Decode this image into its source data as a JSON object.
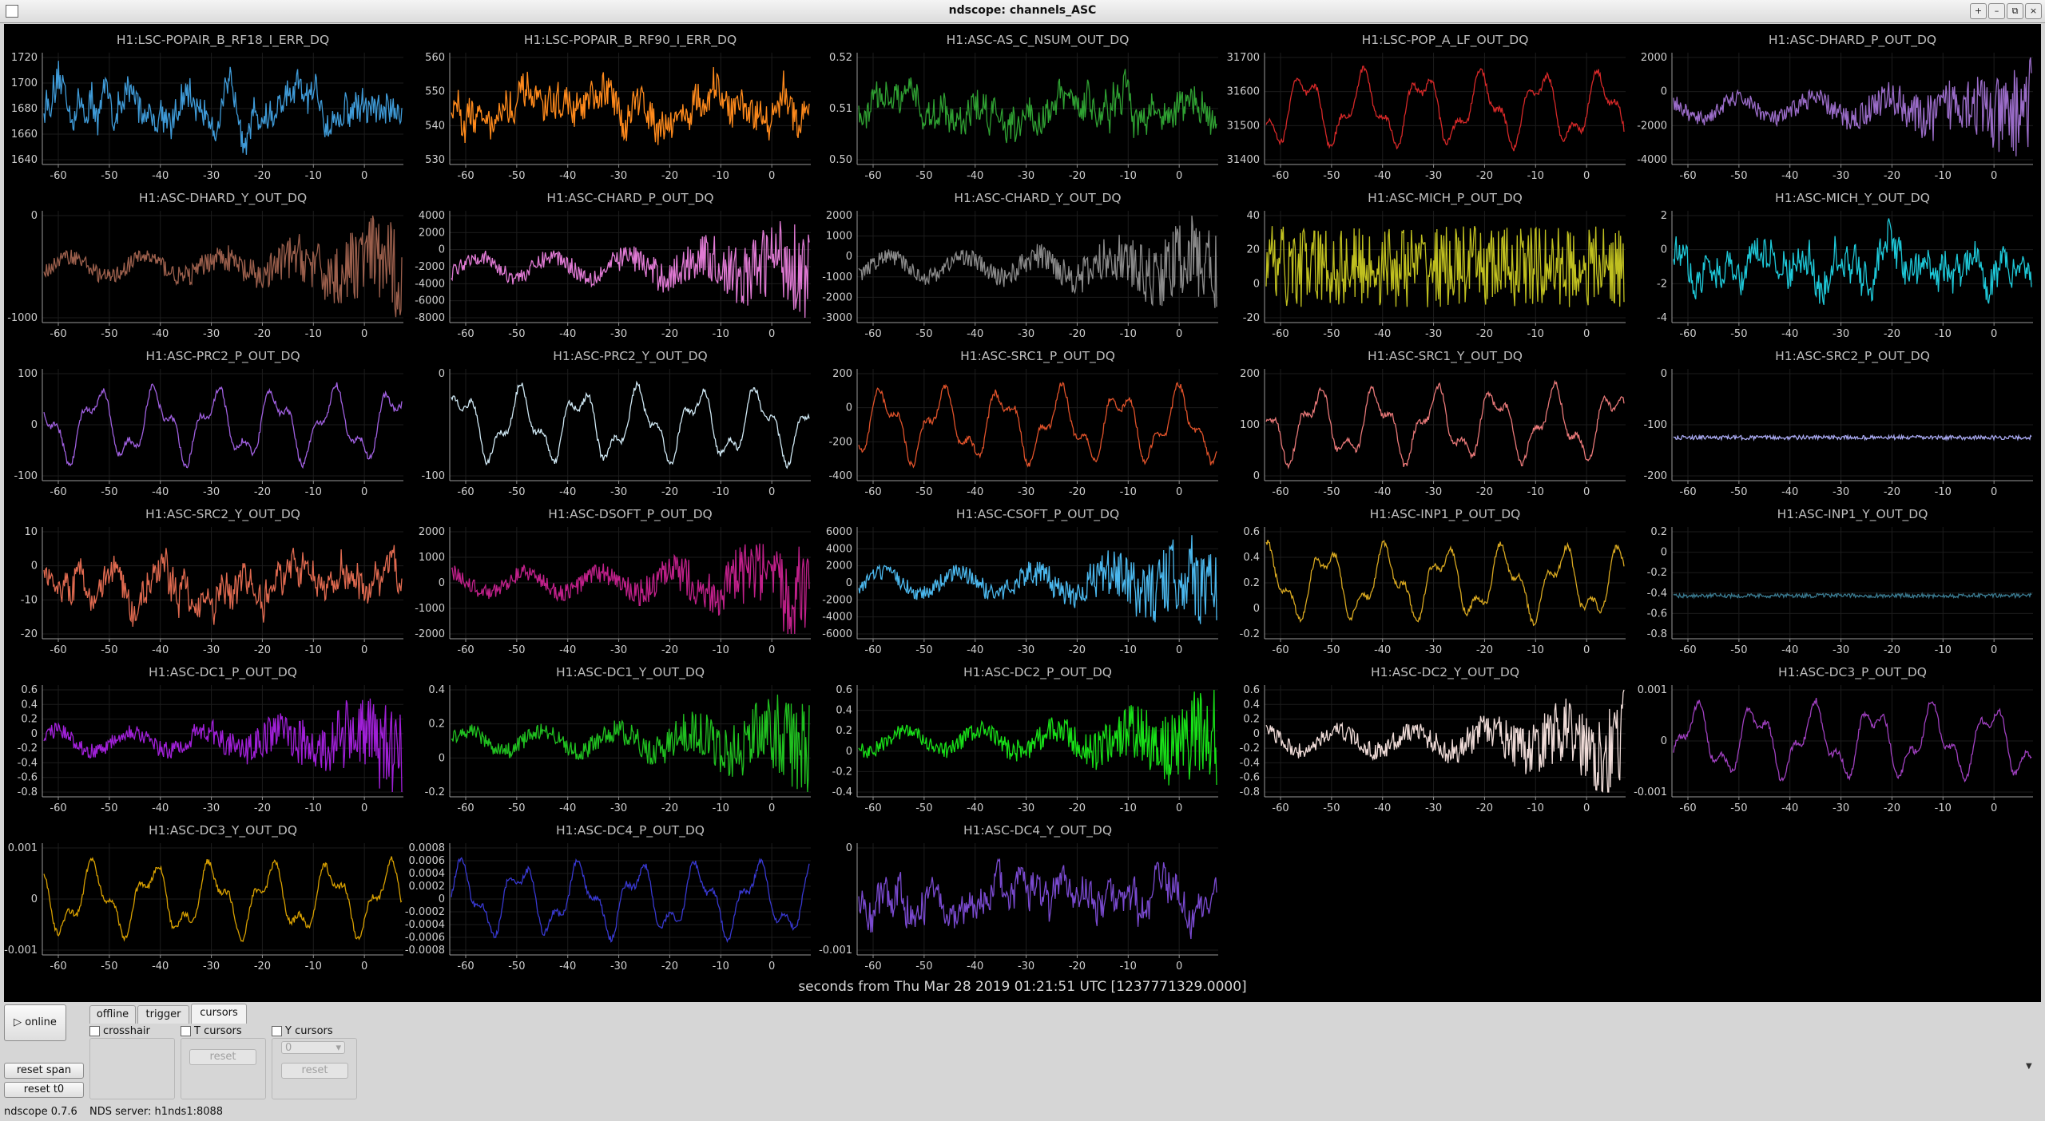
{
  "window": {
    "title": "ndscope: channels_ASC",
    "buttons": [
      "+",
      "–",
      "⧉",
      "×"
    ]
  },
  "plots": [
    {
      "title": "H1:LSC-POPAIR_B_RF18_I_ERR_DQ",
      "color": "#3f9bd8",
      "yticks": [
        "1720",
        "1700",
        "1680",
        "1660",
        "1640"
      ],
      "style": "noise"
    },
    {
      "title": "H1:LSC-POPAIR_B_RF90_I_ERR_DQ",
      "color": "#ff8a1c",
      "yticks": [
        "560",
        "550",
        "540",
        "530"
      ],
      "style": "noise"
    },
    {
      "title": "H1:ASC-AS_C_NSUM_OUT_DQ",
      "color": "#2fa032",
      "yticks": [
        "0.52",
        "0.51",
        "0.50"
      ],
      "style": "noise"
    },
    {
      "title": "H1:LSC-POP_A_LF_OUT_DQ",
      "color": "#d62828",
      "yticks": [
        "31700",
        "31600",
        "31500",
        "31400"
      ],
      "style": "wave"
    },
    {
      "title": "H1:ASC-DHARD_P_OUT_DQ",
      "color": "#9a6cc8",
      "yticks": [
        "2000",
        "0",
        "-2000",
        "-4000"
      ],
      "style": "grow"
    },
    {
      "title": "H1:ASC-DHARD_Y_OUT_DQ",
      "color": "#9b5f4c",
      "yticks": [
        "0",
        "-1000"
      ],
      "style": "grow"
    },
    {
      "title": "H1:ASC-CHARD_P_OUT_DQ",
      "color": "#e07ad4",
      "yticks": [
        "4000",
        "2000",
        "0",
        "-2000",
        "-4000",
        "-6000",
        "-8000"
      ],
      "style": "grow"
    },
    {
      "title": "H1:ASC-CHARD_Y_OUT_DQ",
      "color": "#8a8a8a",
      "yticks": [
        "2000",
        "1000",
        "0",
        "-1000",
        "-2000",
        "-3000"
      ],
      "style": "grow"
    },
    {
      "title": "H1:ASC-MICH_P_OUT_DQ",
      "color": "#c0c020",
      "yticks": [
        "40",
        "20",
        "0",
        "-20"
      ],
      "style": "dense"
    },
    {
      "title": "H1:ASC-MICH_Y_OUT_DQ",
      "color": "#1ec8d8",
      "yticks": [
        "2",
        "0",
        "-2",
        "-4"
      ],
      "style": "noise"
    },
    {
      "title": "H1:ASC-PRC2_P_OUT_DQ",
      "color": "#a060e0",
      "yticks": [
        "100",
        "0",
        "-100"
      ],
      "style": "wave"
    },
    {
      "title": "H1:ASC-PRC2_Y_OUT_DQ",
      "color": "#cfe8f4",
      "yticks": [
        "0",
        "-100"
      ],
      "style": "wave"
    },
    {
      "title": "H1:ASC-SRC1_P_OUT_DQ",
      "color": "#e0522a",
      "yticks": [
        "200",
        "0",
        "-200",
        "-400"
      ],
      "style": "wave"
    },
    {
      "title": "H1:ASC-SRC1_Y_OUT_DQ",
      "color": "#e87878",
      "yticks": [
        "200",
        "100",
        "0"
      ],
      "style": "wave"
    },
    {
      "title": "H1:ASC-SRC2_P_OUT_DQ",
      "color": "#a8a8f0",
      "yticks": [
        "0",
        "-100",
        "-200"
      ],
      "style": "flat"
    },
    {
      "title": "H1:ASC-SRC2_Y_OUT_DQ",
      "color": "#e06a50",
      "yticks": [
        "10",
        "0",
        "-10",
        "-20"
      ],
      "style": "noise"
    },
    {
      "title": "H1:ASC-DSOFT_P_OUT_DQ",
      "color": "#c0208a",
      "yticks": [
        "2000",
        "1000",
        "0",
        "-1000",
        "-2000"
      ],
      "style": "grow"
    },
    {
      "title": "H1:ASC-CSOFT_P_OUT_DQ",
      "color": "#4bb8ee",
      "yticks": [
        "6000",
        "4000",
        "2000",
        "0",
        "-2000",
        "-4000",
        "-6000"
      ],
      "style": "grow"
    },
    {
      "title": "H1:ASC-INP1_P_OUT_DQ",
      "color": "#d8a820",
      "yticks": [
        "0.6",
        "0.4",
        "0.2",
        "0",
        "-0.2"
      ],
      "style": "wave"
    },
    {
      "title": "H1:ASC-INP1_Y_OUT_DQ",
      "color": "#3a7a90",
      "yticks": [
        "0.2",
        "0",
        "-0.2",
        "-0.4",
        "-0.6",
        "-0.8"
      ],
      "style": "flat"
    },
    {
      "title": "H1:ASC-DC1_P_OUT_DQ",
      "color": "#a020d8",
      "yticks": [
        "0.6",
        "0.4",
        "0.2",
        "0",
        "-0.2",
        "-0.4",
        "-0.6",
        "-0.8"
      ],
      "style": "grow"
    },
    {
      "title": "H1:ASC-DC1_Y_OUT_DQ",
      "color": "#20c020",
      "yticks": [
        "0.4",
        "0.2",
        "0",
        "-0.2"
      ],
      "style": "grow"
    },
    {
      "title": "H1:ASC-DC2_P_OUT_DQ",
      "color": "#18e018",
      "yticks": [
        "0.6",
        "0.4",
        "0.2",
        "0",
        "-0.2",
        "-0.4"
      ],
      "style": "grow"
    },
    {
      "title": "H1:ASC-DC2_Y_OUT_DQ",
      "color": "#f0dcd8",
      "yticks": [
        "0.6",
        "0.4",
        "0.2",
        "0",
        "-0.2",
        "-0.4",
        "-0.6",
        "-0.8"
      ],
      "style": "grow"
    },
    {
      "title": "H1:ASC-DC3_P_OUT_DQ",
      "color": "#a040c0",
      "yticks": [
        "0.001",
        "0",
        "-0.001"
      ],
      "style": "wave"
    },
    {
      "title": "H1:ASC-DC3_Y_OUT_DQ",
      "color": "#d8a000",
      "yticks": [
        "0.001",
        "0",
        "-0.001"
      ],
      "style": "wave"
    },
    {
      "title": "H1:ASC-DC4_P_OUT_DQ",
      "color": "#3838d0",
      "yticks": [
        "0.0008",
        "0.0006",
        "0.0004",
        "0.0002",
        "0",
        "-0.0002",
        "-0.0004",
        "-0.0006",
        "-0.0008"
      ],
      "style": "wave"
    },
    {
      "title": "H1:ASC-DC4_Y_OUT_DQ",
      "color": "#7a4ad0",
      "yticks": [
        "0",
        "-0.001"
      ],
      "style": "noise"
    }
  ],
  "xticks": [
    "-60",
    "-50",
    "-40",
    "-30",
    "-20",
    "-10",
    "0"
  ],
  "xaxis_label": "seconds from Thu Mar 28 2019 01:21:51 UTC [1237771329.0000]",
  "controls": {
    "online_label": "▷ online",
    "reset_span_label": "reset span",
    "reset_t0_label": "reset t0",
    "tabs": [
      "offline",
      "trigger",
      "cursors"
    ],
    "active_tab": "cursors",
    "crosshair_label": "crosshair",
    "t_cursors_label": "T cursors",
    "y_cursors_label": "Y cursors",
    "reset_label": "reset",
    "y_select_value": "0"
  },
  "status": {
    "version": "ndscope 0.7.6",
    "server": "NDS server: h1nds1:8088"
  }
}
